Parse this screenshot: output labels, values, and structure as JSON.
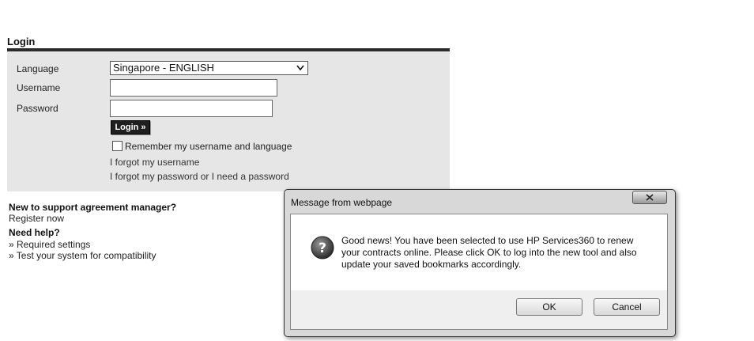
{
  "login": {
    "title": "Login",
    "language_label": "Language",
    "language_value": "Singapore - ENGLISH",
    "username_label": "Username",
    "password_label": "Password",
    "login_button": "Login »",
    "remember_label": "Remember my username and language",
    "forgot_username": "I forgot my username",
    "forgot_password": "I forgot my password or I need a password"
  },
  "side": {
    "new_heading": "New to support agreement manager?",
    "register": "Register now",
    "help_heading": "Need help?",
    "required_settings": "» Required settings",
    "test_system": "» Test your system for compatibility"
  },
  "dialog": {
    "title": "Message from webpage",
    "close_glyph": "x",
    "message": "Good news! You have been selected to use HP Services360 to renew your contracts online. Please click OK to log into the new tool and also update your saved bookmarks accordingly.",
    "ok": "OK",
    "cancel": "Cancel"
  }
}
